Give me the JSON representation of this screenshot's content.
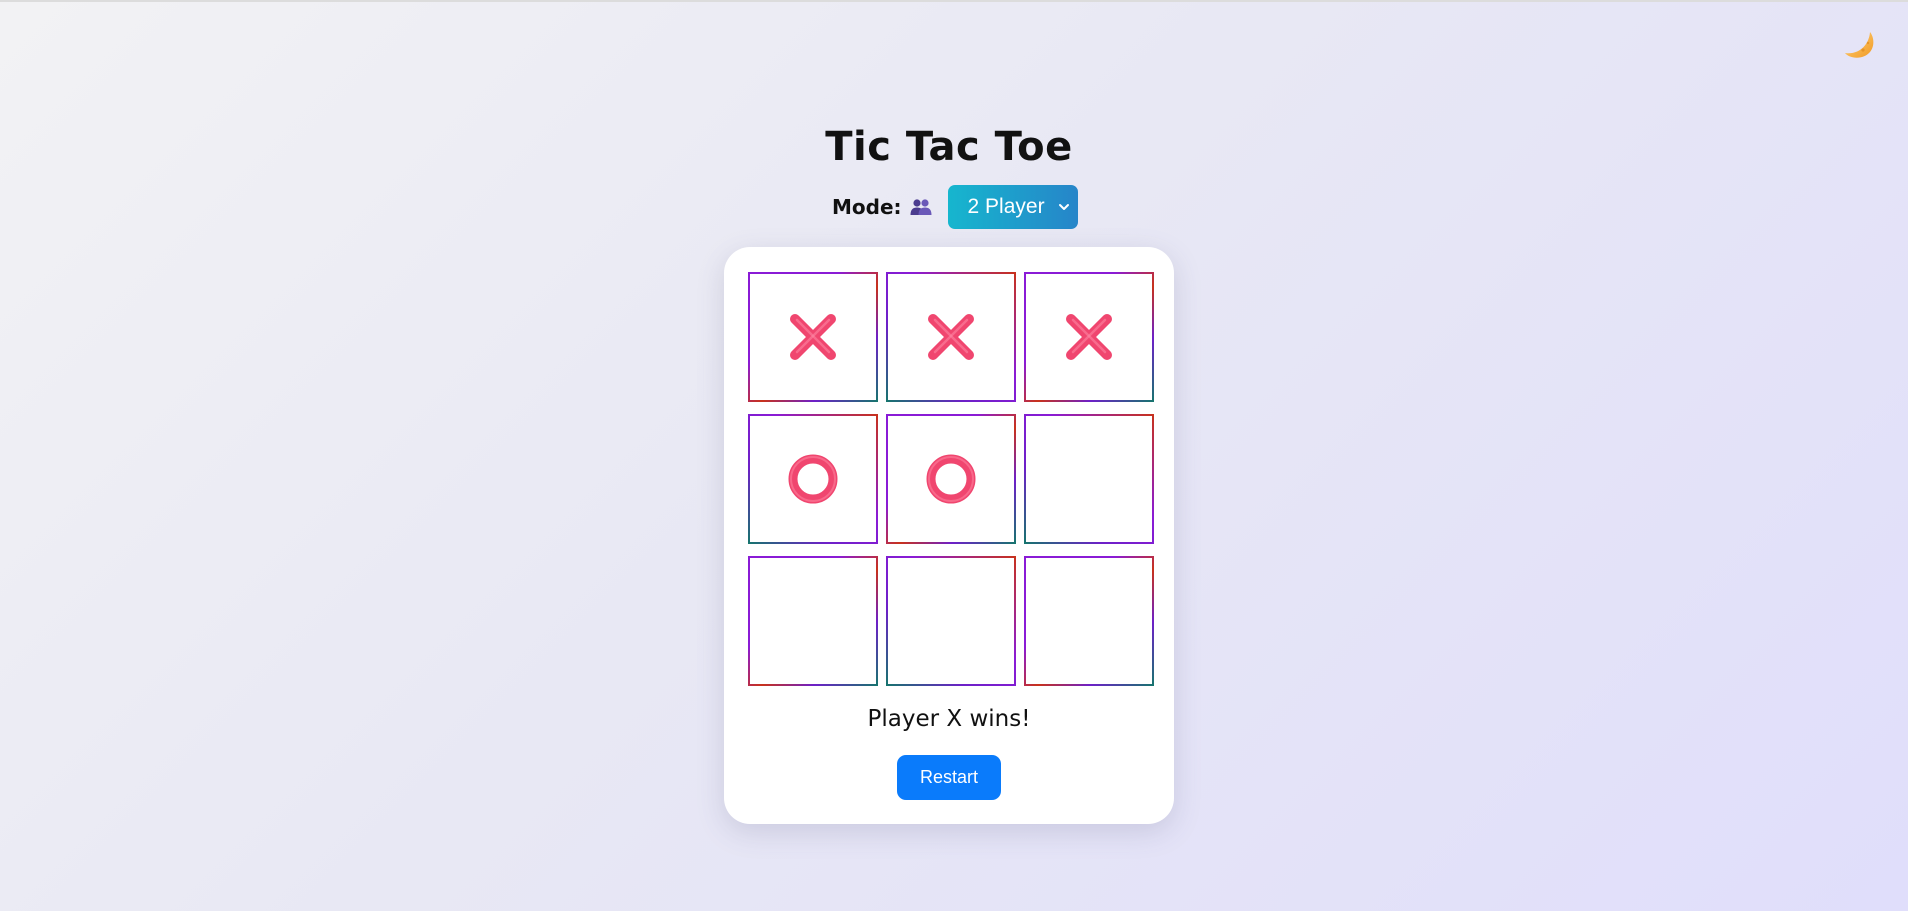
{
  "app": {
    "title": "Tic Tac Toe",
    "theme_toggle_icon": "crescent-moon-icon"
  },
  "mode": {
    "label": "Mode:",
    "icon": "two-players-icon",
    "selected": "2 Player"
  },
  "board": {
    "cells": [
      "X",
      "X",
      "X",
      "O",
      "O",
      "",
      "",
      "",
      ""
    ]
  },
  "status": "Player X wins!",
  "restart_label": "Restart",
  "colors": {
    "mark": "#f0466f",
    "restart_button": "#0a7bfb",
    "select_gradient_start": "#16b6ce",
    "select_gradient_end": "#2685c9"
  }
}
